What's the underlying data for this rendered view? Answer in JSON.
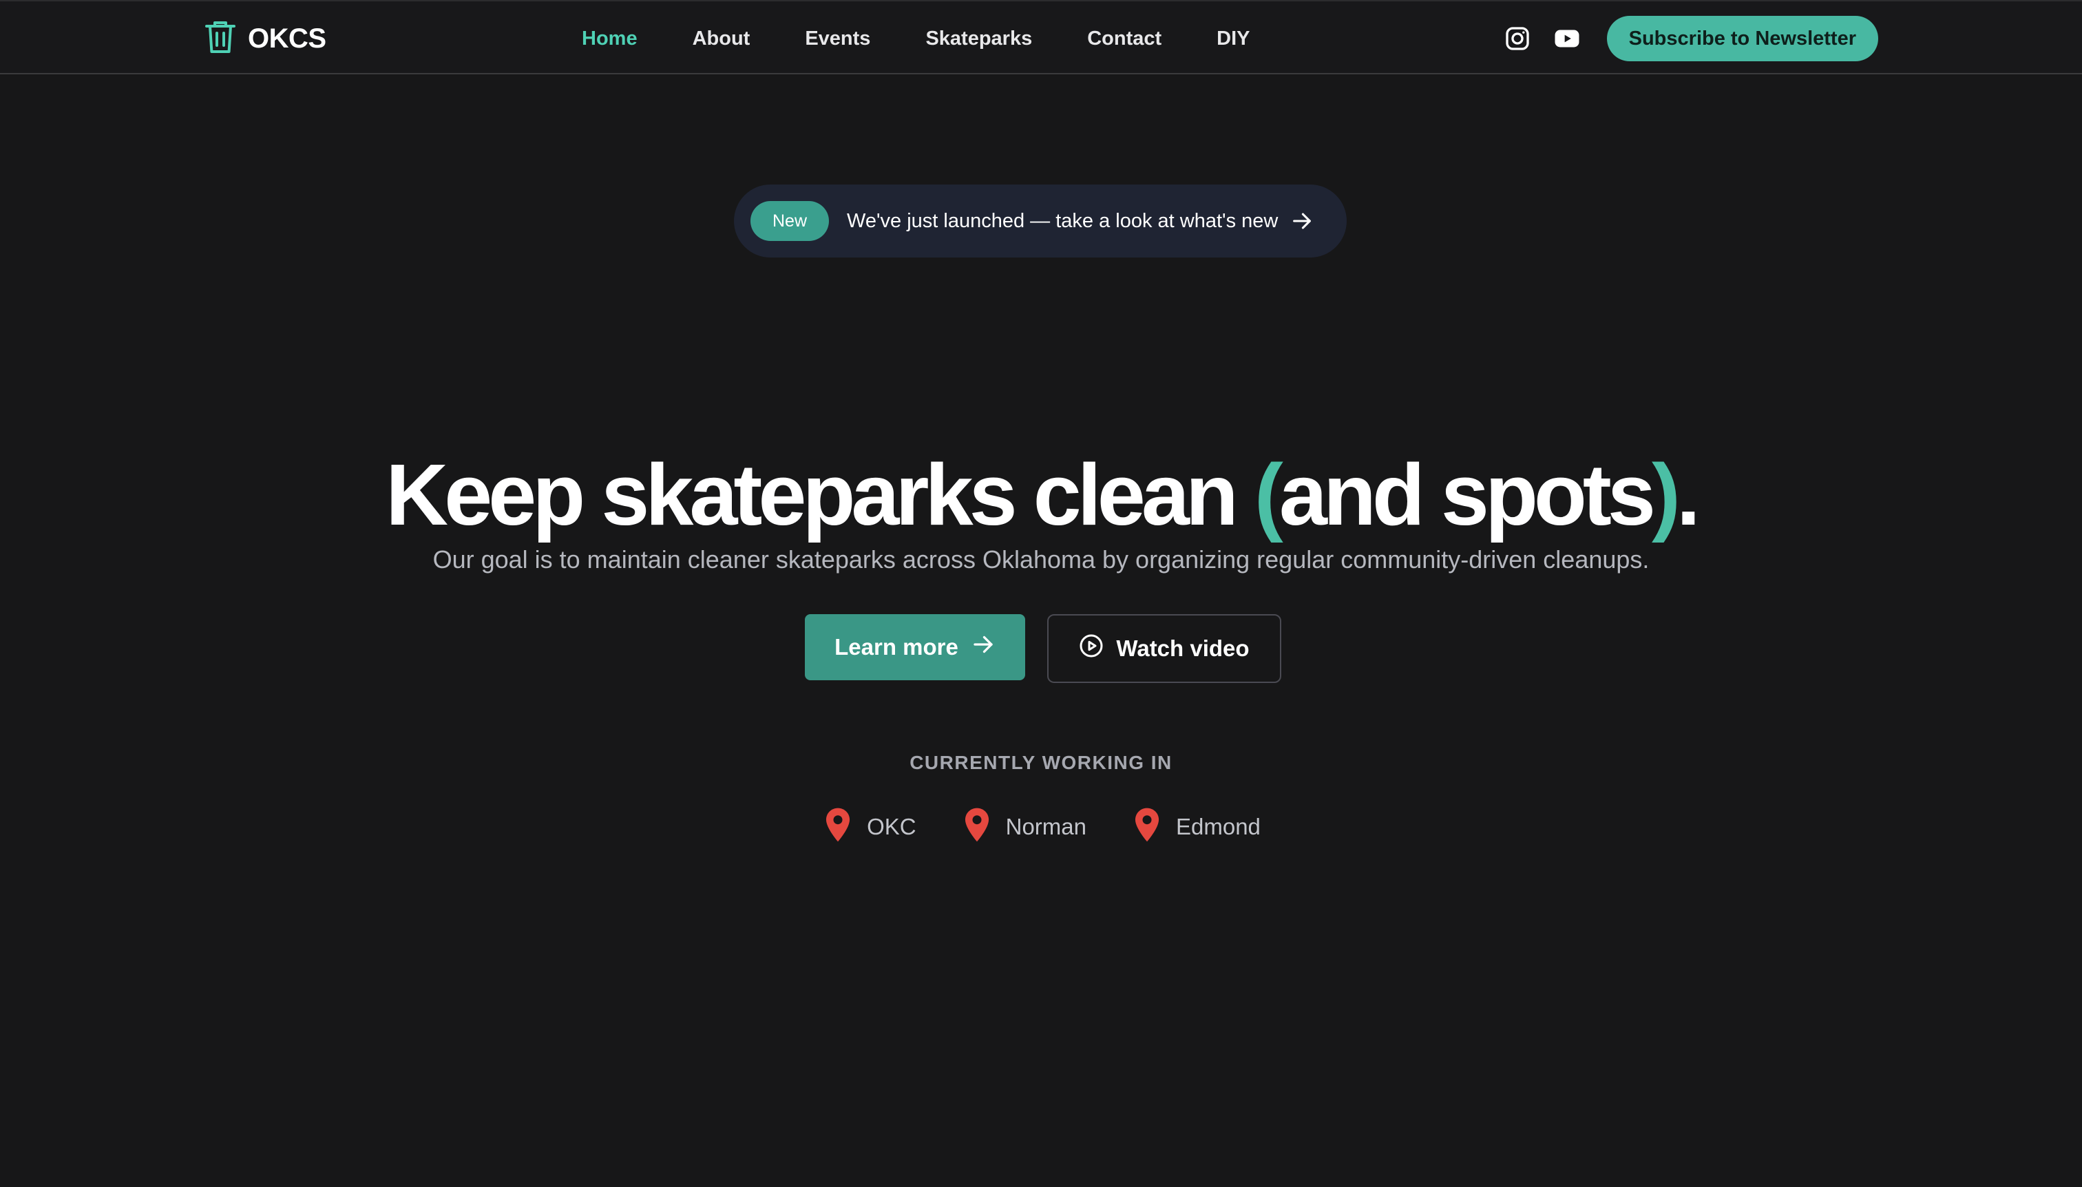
{
  "brand": {
    "name": "OKCS",
    "icon": "trash-can-icon",
    "accent_color": "#4fd1b5"
  },
  "nav": {
    "links": [
      {
        "label": "Home",
        "active": true
      },
      {
        "label": "About",
        "active": false
      },
      {
        "label": "Events",
        "active": false
      },
      {
        "label": "Skateparks",
        "active": false
      },
      {
        "label": "Contact",
        "active": false
      },
      {
        "label": "DIY",
        "active": false
      }
    ],
    "social_icons": [
      "instagram-icon",
      "youtube-icon"
    ],
    "subscribe_label": "Subscribe to Newsletter"
  },
  "announcement": {
    "badge": "New",
    "text": "We've just launched — take a look at what's new",
    "icon": "arrow-right-icon"
  },
  "hero": {
    "headline_main": "Keep skateparks clean ",
    "headline_paren_open": "(",
    "headline_paren_inner": "and spots",
    "headline_paren_close": ")",
    "headline_end": ".",
    "subtitle": "Our goal is to maintain cleaner skateparks across Oklahoma by organizing regular community-driven cleanups."
  },
  "cta": {
    "primary_label": "Learn more",
    "primary_icon": "arrow-right-icon",
    "secondary_label": "Watch video",
    "secondary_icon": "play-circle-icon"
  },
  "locations": {
    "label": "CURRENTLY WORKING IN",
    "pin_color": "#e5483f",
    "items": [
      "OKC",
      "Norman",
      "Edmond"
    ]
  },
  "colors": {
    "background": "#171718",
    "primary_button": "#3a9786",
    "subscribe_button": "#48b8a2"
  }
}
